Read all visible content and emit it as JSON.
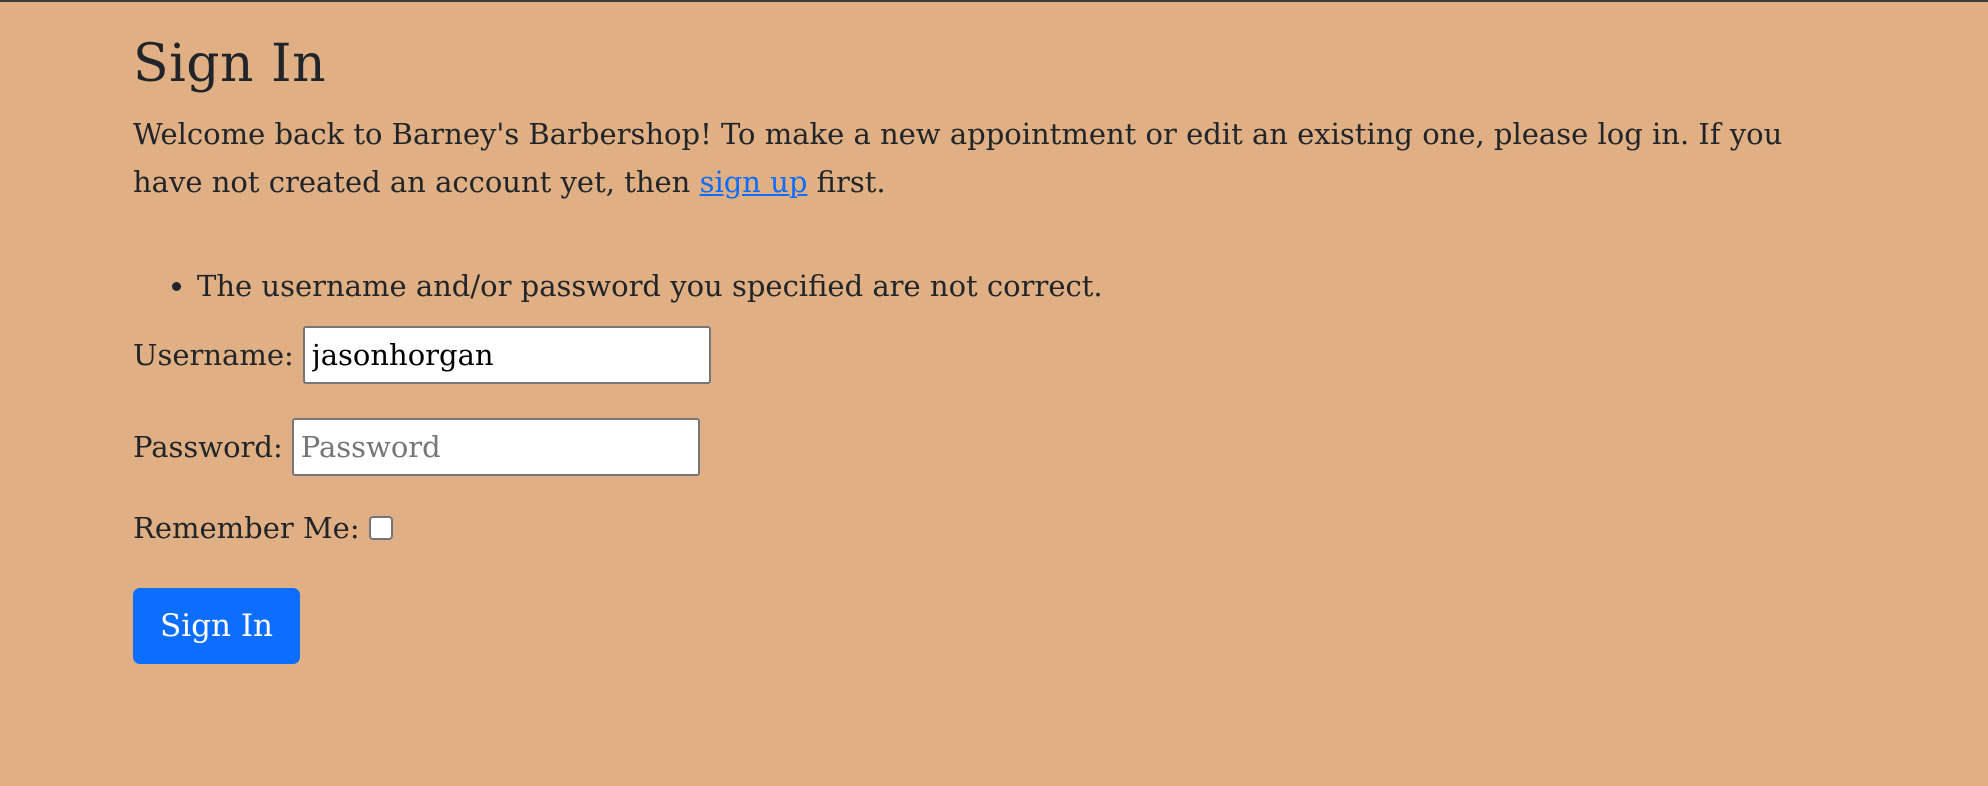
{
  "page": {
    "title": "Sign In",
    "intro_before_link": "Welcome back to Barney's Barbershop! To make a new appointment or edit an existing one, please log in. If you have not created an account yet, then ",
    "intro_link": "sign up",
    "intro_after_link": " first."
  },
  "errors": [
    "The username and/or password you specified are not correct."
  ],
  "form": {
    "username_label": "Username:",
    "username_value": "jasonhorgan",
    "password_label": "Password:",
    "password_placeholder": "Password",
    "password_value": "",
    "remember_label": "Remember Me:",
    "remember_checked": false,
    "submit_label": "Sign In"
  },
  "colors": {
    "background": "#e0b084",
    "accent": "#0d6efd",
    "text": "#212529"
  }
}
